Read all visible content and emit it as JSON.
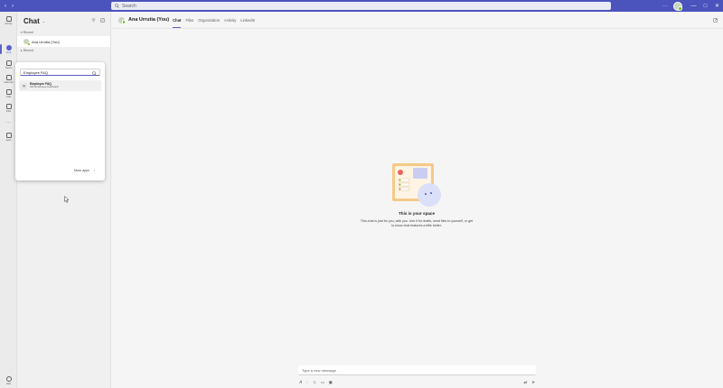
{
  "titlebar": {
    "back": "‹",
    "forward": "›",
    "search_placeholder": "Search",
    "more": "···",
    "minimize": "—",
    "maximize": "□",
    "close": "✕"
  },
  "rail": [
    {
      "name": "activity",
      "label": "Activity"
    },
    {
      "name": "chat",
      "label": "Chat"
    },
    {
      "name": "teams",
      "label": "Teams"
    },
    {
      "name": "calendar",
      "label": "Calendar"
    },
    {
      "name": "calls",
      "label": "Calls"
    },
    {
      "name": "files",
      "label": "Files"
    },
    {
      "name": "more",
      "label": "···"
    },
    {
      "name": "apps",
      "label": "Apps"
    },
    {
      "name": "help",
      "label": "Help"
    }
  ],
  "chatlist": {
    "title": "Chat",
    "section_recent": "Recent",
    "section_more": "Recent",
    "items": [
      {
        "name": "Ana Urrutia (You)"
      }
    ]
  },
  "popup": {
    "search_value": "Employee FAQ",
    "result_title": "Employee FAQ",
    "result_subtitle": "HR Employee feedback",
    "more_apps": "More apps",
    "more_arrow": "›"
  },
  "main": {
    "user_name": "Ana Urrutia (You)",
    "tabs": [
      "Chat",
      "Files",
      "Organization",
      "Activity",
      "LinkedIn"
    ],
    "space_title": "This is your space",
    "space_desc": "This chat is just for you, with you. Use it for drafts, send files to yourself, or get to know chat features a little better.",
    "compose_placeholder": "Type a new message"
  },
  "colors": {
    "accent": "#5b5fc7",
    "titlebar": "#4b53bc",
    "presence": "#6bb700"
  }
}
